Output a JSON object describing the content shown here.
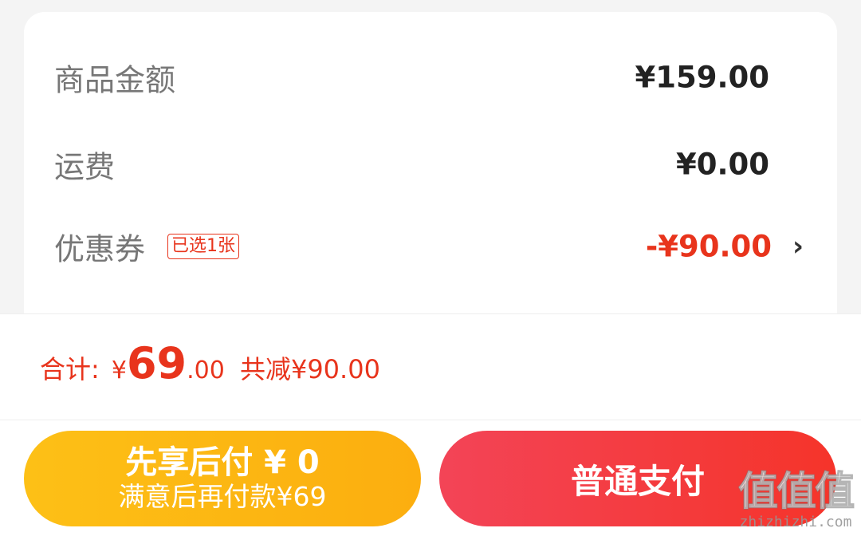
{
  "summary": {
    "goods_amount": {
      "label": "商品金额",
      "value": "¥159.00"
    },
    "shipping": {
      "label": "运费",
      "value": "¥0.00"
    },
    "coupon": {
      "label": "优惠券",
      "badge": "已选1张",
      "value": "-¥90.00",
      "chevron_icon": "chevron-right-icon"
    }
  },
  "total": {
    "label": "合计:",
    "currency": "¥",
    "amount_int": "69",
    "amount_dec": ".00",
    "savings": "共减¥90.00"
  },
  "buttons": {
    "bnpl": {
      "label": "先享后付 ¥ 0",
      "sublabel": "满意后再付款¥69"
    },
    "pay": {
      "label": "普通支付"
    }
  },
  "watermark": {
    "logo": "值值值",
    "url": "zhizhizhi.com"
  },
  "colors": {
    "accent_red": "#e8341c",
    "bnpl_gradient": [
      "#fdc016",
      "#fcae0f"
    ],
    "pay_gradient": [
      "#f34457",
      "#f5342a"
    ]
  }
}
